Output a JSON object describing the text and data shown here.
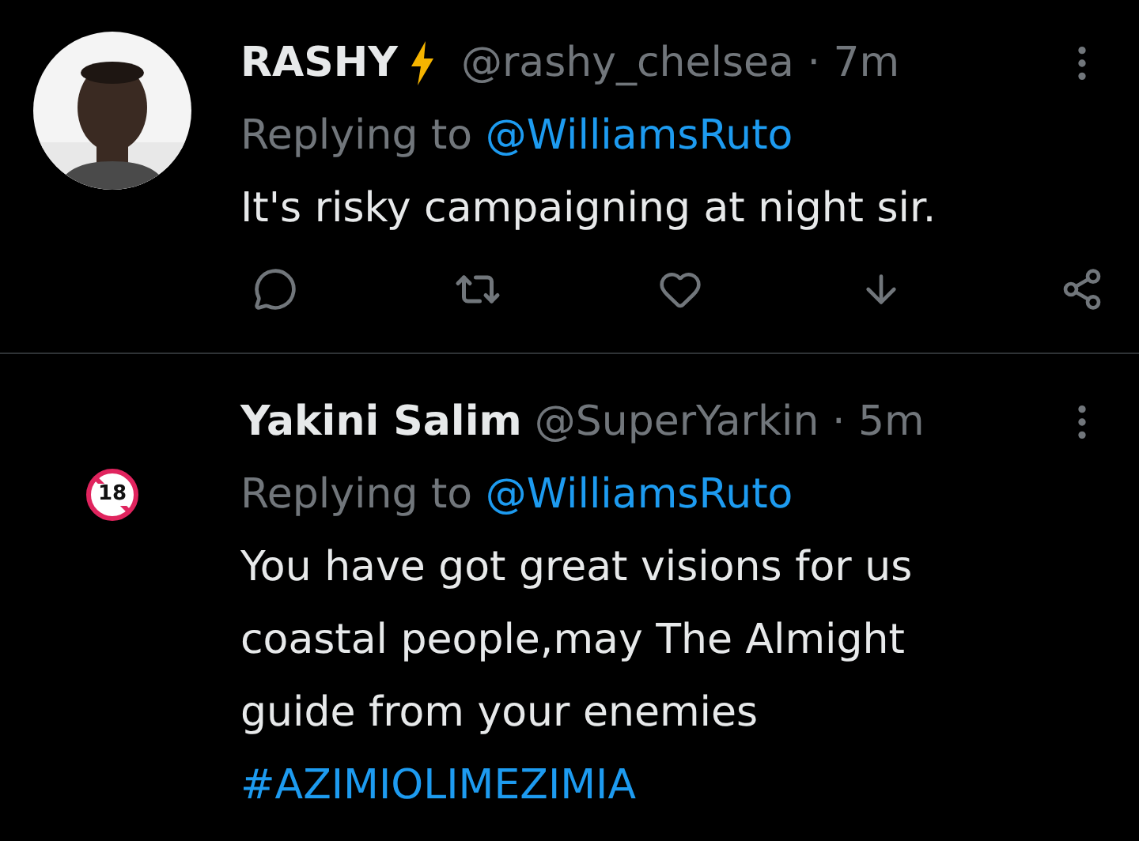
{
  "tweets": [
    {
      "avatar": {
        "kind": "picture"
      },
      "name": "RASHY",
      "verified_emoji": true,
      "handle": "@rashy_chelsea · 7m",
      "replying_label": "Replying to",
      "replying_to": "@WilliamsRuto",
      "text_lines": [
        "It's risky campaigning at night sir."
      ],
      "actions": true
    },
    {
      "avatar": {
        "kind": "badge",
        "label": "18"
      },
      "name": "Yakini Salim",
      "verified_emoji": false,
      "handle": "@SuperYarkin · 5m",
      "replying_label": "Replying to",
      "replying_to": "@WilliamsRuto",
      "text_lines": [
        "You have got great visions for us",
        "coastal people,may The Almight",
        "guide from your enemies"
      ],
      "hashtag": "#AZIMIOLIMEZIMIA",
      "actions": false
    }
  ]
}
